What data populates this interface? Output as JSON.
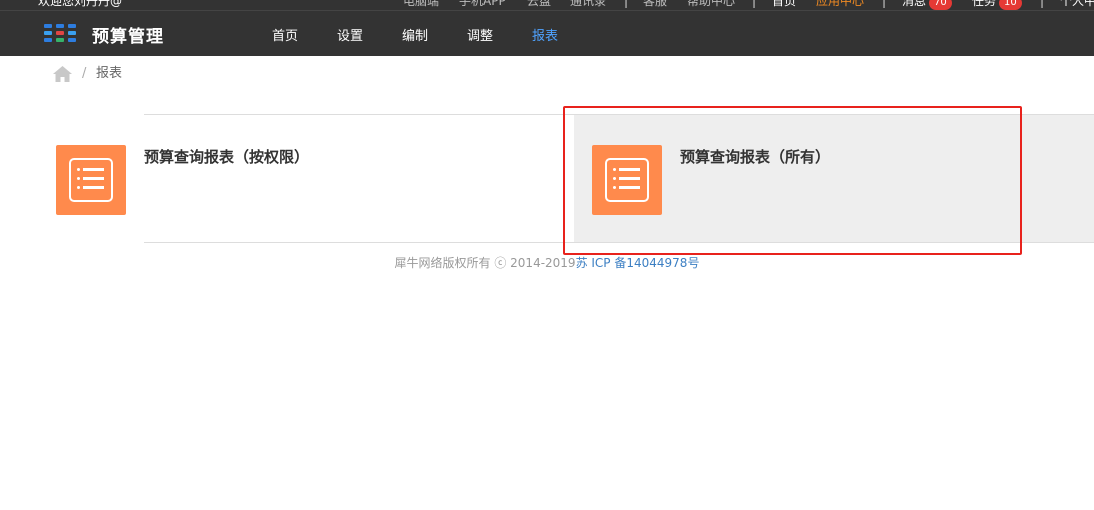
{
  "topbar": {
    "welcome": "欢迎您刘丹丹@",
    "links": [
      "电脑端",
      "手机APP",
      "云盘",
      "通讯录"
    ],
    "links2": [
      "客服",
      "帮助中心"
    ],
    "home": "首页",
    "app_center": "应用中心",
    "messages": {
      "label": "消息",
      "count": "70"
    },
    "tasks": {
      "label": "任务",
      "count": "10"
    },
    "profile": "个人中"
  },
  "nav": {
    "app_title": "预算管理",
    "items": [
      {
        "label": "首页",
        "active": false
      },
      {
        "label": "设置",
        "active": false
      },
      {
        "label": "编制",
        "active": false
      },
      {
        "label": "调整",
        "active": false
      },
      {
        "label": "报表",
        "active": true
      }
    ]
  },
  "breadcrumb": {
    "separator": "/",
    "current": "报表"
  },
  "reports": [
    {
      "title": "预算查询报表（按权限）",
      "icon": "report-list-icon"
    },
    {
      "title": "预算查询报表（所有）",
      "icon": "report-list-icon",
      "highlighted": true
    }
  ],
  "footer": {
    "copyright": "犀牛网络版权所有 ⓒ 2014-2019",
    "icp": "苏 ICP 备14044978号"
  },
  "colors": {
    "nav_bg": "#333333",
    "active_nav": "#4fa3ff",
    "icon_bg": "#ff8a4c",
    "highlight_border": "#e8221c",
    "link": "#3c7fc3"
  }
}
